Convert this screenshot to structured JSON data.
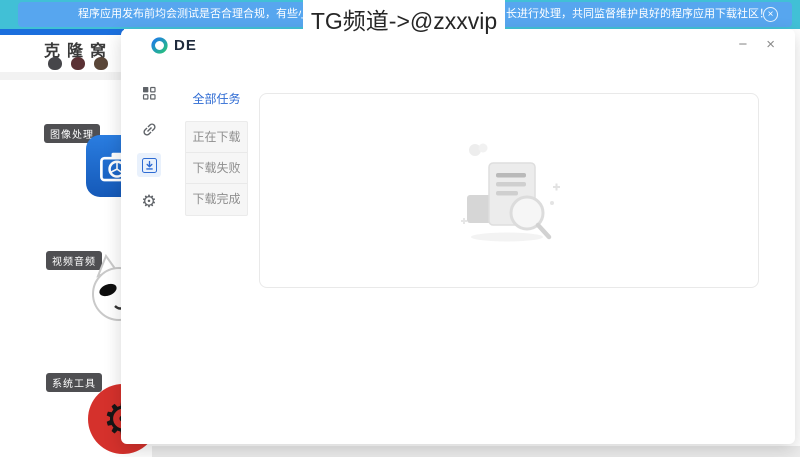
{
  "banner": {
    "message_left": "程序应用发布前均会测试是否合理合规，有些小类联网软件后期可能",
    "message_right": "长进行处理，共同监督维护良好的程序应用下载社区！",
    "close_label": "×",
    "teal_color": "#41C0D6",
    "blue_color": "#57A6EF"
  },
  "watermark": {
    "text": "TG频道->@zxxvip"
  },
  "background_window": {
    "app_name": "克隆窝",
    "categories": [
      {
        "label": "图像处理",
        "icon": "camera-app-icon"
      },
      {
        "label": "视频音频",
        "icon": "cat-app-icon"
      },
      {
        "label": "系统工具",
        "icon": "gear-app-icon"
      }
    ]
  },
  "dialog": {
    "logo_text": "DE",
    "accent_color": "#2E6BD3",
    "controls": {
      "minimize": "−",
      "close": "×"
    },
    "nav_icons": [
      "apps-icon",
      "link-icon",
      "download-icon",
      "settings-icon"
    ],
    "tabs": [
      {
        "label": "全部任务",
        "active": true
      },
      {
        "label": "正在下载",
        "active": false
      },
      {
        "label": "下载失败",
        "active": false
      },
      {
        "label": "下载完成",
        "active": false
      }
    ]
  }
}
